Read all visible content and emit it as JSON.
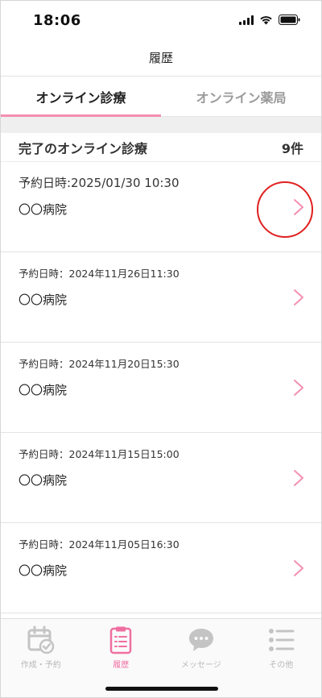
{
  "status_bar": {
    "time": "18:06"
  },
  "nav": {
    "title": "履歴"
  },
  "tabs": [
    {
      "label": "オンライン診療",
      "active": true
    },
    {
      "label": "オンライン薬局",
      "active": false
    }
  ],
  "section": {
    "title": "完了のオンライン診療",
    "count": "9件"
  },
  "records": [
    {
      "date": "予約日時:2025/01/30  10:30",
      "name": "〇〇病院",
      "highlighted": true
    },
    {
      "date": "予約日時：2024年11月26日11:30",
      "name": "〇〇病院",
      "highlighted": false
    },
    {
      "date": "予約日時：2024年11月20日15:30",
      "name": "〇〇病院",
      "highlighted": false
    },
    {
      "date": "予約日時：2024年11月15日15:00",
      "name": "〇〇病院",
      "highlighted": false
    },
    {
      "date": "予約日時：2024年11月05日16:30",
      "name": "〇〇病院",
      "highlighted": false
    }
  ],
  "bottom_nav": [
    {
      "label": "作成・予約",
      "icon": "calendar-check-icon",
      "active": false
    },
    {
      "label": "履歴",
      "icon": "clipboard-list-icon",
      "active": true
    },
    {
      "label": "メッセージ",
      "icon": "chat-bubble-icon",
      "active": false
    },
    {
      "label": "その他",
      "icon": "menu-list-icon",
      "active": false
    }
  ],
  "colors": {
    "accent": "#f48fb1",
    "active_nav": "#ef6fa0",
    "highlight": "#e02020"
  }
}
